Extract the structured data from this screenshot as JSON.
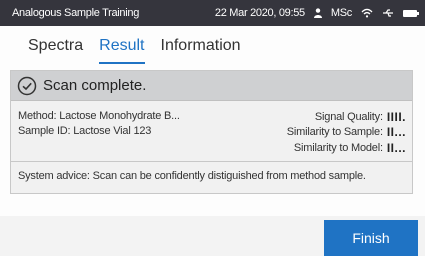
{
  "statusbar": {
    "app_title": "Analogous Sample Training",
    "datetime": "22 Mar 2020, 09:55",
    "user": "MSc",
    "icons": [
      "user-icon",
      "wifi-icon",
      "usb-icon",
      "battery-icon"
    ]
  },
  "tabs": [
    {
      "label": "Spectra",
      "active": false
    },
    {
      "label": "Result",
      "active": true
    },
    {
      "label": "Information",
      "active": false
    }
  ],
  "result": {
    "status": "Scan complete.",
    "method": "Method:  Lactose Monohydrate B...",
    "sample_id": "Sample ID:  Lactose Vial 123",
    "signal_quality_label": "Signal Quality:",
    "signal_quality_value": "IIII.",
    "similarity_sample_label": "Similarity to Sample:",
    "similarity_sample_value": "II...",
    "similarity_model_label": "Similarity to Model:",
    "similarity_model_value": "II...",
    "advice": "System advice:  Scan can be confidently distiguished from method sample."
  },
  "footer": {
    "finish_label": "Finish"
  },
  "colors": {
    "accent": "#1f73c4",
    "statusbar_bg": "#35353d",
    "panel_header_bg": "#cfd0d2"
  }
}
